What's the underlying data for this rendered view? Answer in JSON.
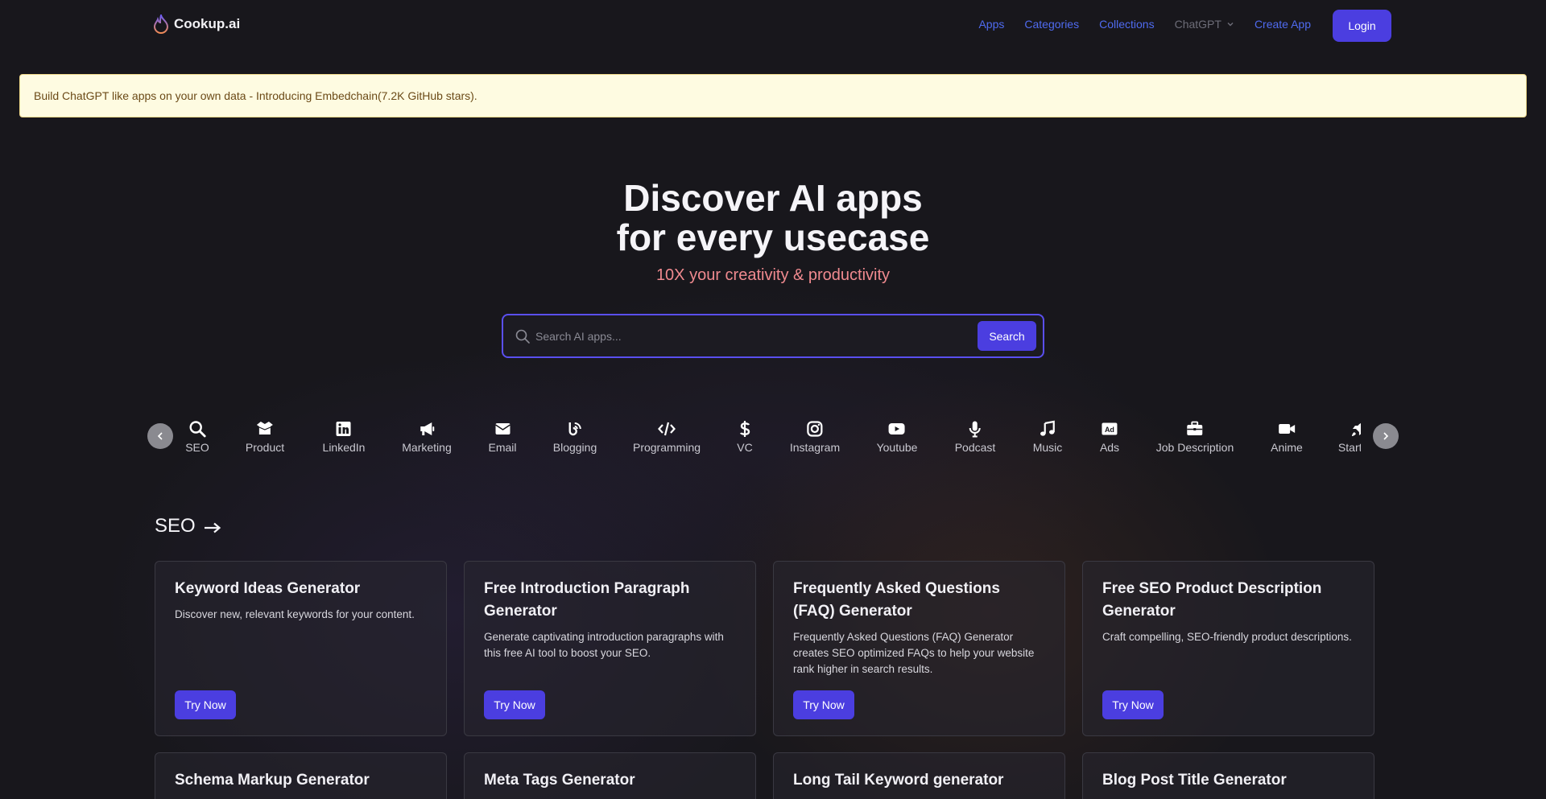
{
  "brand": {
    "name": "Cookup.ai"
  },
  "nav": {
    "links": [
      "Apps",
      "Categories",
      "Collections",
      "ChatGPT",
      "Create App"
    ],
    "login": "Login"
  },
  "banner": {
    "text": "Build ChatGPT like apps on your own data - Introducing Embedchain(7.2K GitHub stars)."
  },
  "hero": {
    "title_line1": "Discover AI apps",
    "title_line2": "for every usecase",
    "subtitle": "10X your creativity & productivity"
  },
  "search": {
    "placeholder": "Search AI apps...",
    "button": "Search"
  },
  "categories": [
    {
      "label": "SEO",
      "icon": "search-icon"
    },
    {
      "label": "Product",
      "icon": "box-open-icon"
    },
    {
      "label": "LinkedIn",
      "icon": "linkedin-icon"
    },
    {
      "label": "Marketing",
      "icon": "megaphone-icon"
    },
    {
      "label": "Email",
      "icon": "envelope-icon"
    },
    {
      "label": "Blogging",
      "icon": "blog-icon"
    },
    {
      "label": "Programming",
      "icon": "code-icon"
    },
    {
      "label": "VC",
      "icon": "dollar-icon"
    },
    {
      "label": "Instagram",
      "icon": "instagram-icon"
    },
    {
      "label": "Youtube",
      "icon": "youtube-icon"
    },
    {
      "label": "Podcast",
      "icon": "microphone-icon"
    },
    {
      "label": "Music",
      "icon": "music-icon"
    },
    {
      "label": "Ads",
      "icon": "ad-icon"
    },
    {
      "label": "Job Description",
      "icon": "briefcase-icon"
    },
    {
      "label": "Anime",
      "icon": "video-icon"
    },
    {
      "label": "Startups",
      "icon": "rocket-icon"
    }
  ],
  "section": {
    "title": "SEO"
  },
  "cards": [
    {
      "title": "Keyword Ideas Generator",
      "desc": "Discover new, relevant keywords for your content.",
      "button": "Try Now"
    },
    {
      "title": "Free Introduction Paragraph Generator",
      "desc": "Generate captivating introduction paragraphs with this free AI tool to boost your SEO.",
      "button": "Try Now"
    },
    {
      "title": "Frequently Asked Questions (FAQ) Generator",
      "desc": "Frequently Asked Questions (FAQ) Generator creates SEO optimized FAQs to help your website rank higher in search results.",
      "button": "Try Now"
    },
    {
      "title": "Free SEO Product Description Generator",
      "desc": "Craft compelling, SEO-friendly product descriptions.",
      "button": "Try Now"
    },
    {
      "title": "Schema Markup Generator"
    },
    {
      "title": "Meta Tags Generator"
    },
    {
      "title": "Long Tail Keyword generator"
    },
    {
      "title": "Blog Post Title Generator"
    }
  ],
  "colors": {
    "accent": "#4b3ee0",
    "link": "#4f6bf0",
    "subtitle": "#f08a8f",
    "banner_bg": "#fefbe1"
  }
}
